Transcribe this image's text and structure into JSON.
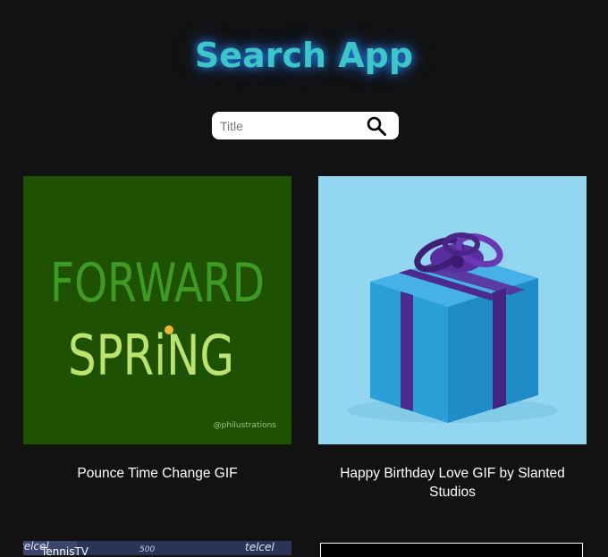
{
  "app": {
    "title": "Search App"
  },
  "search": {
    "placeholder": "Title"
  },
  "results": [
    {
      "caption": "Pounce Time Change GIF",
      "image_text": [
        "FORWARD",
        "SPRiNG"
      ],
      "watermark": "@philustrations",
      "colors": {
        "background": "#1f5200",
        "word1": "#3f9a22",
        "word2": "#bce270",
        "dot": "#f2b632"
      }
    },
    {
      "caption": "Happy Birthday Love GIF by Slanted Studios",
      "colors": {
        "background": "#93d6ef",
        "box": "#2a9fd7",
        "ribbon": "#4c2a8e"
      }
    },
    {
      "caption": "",
      "image_text": [
        "TennisTV",
        "telcel",
        "telcel",
        "500"
      ],
      "colors": {
        "background": "#2a3456"
      }
    },
    {
      "caption": "",
      "colors": {
        "background": "#000000",
        "border": "#ffffff"
      }
    }
  ]
}
